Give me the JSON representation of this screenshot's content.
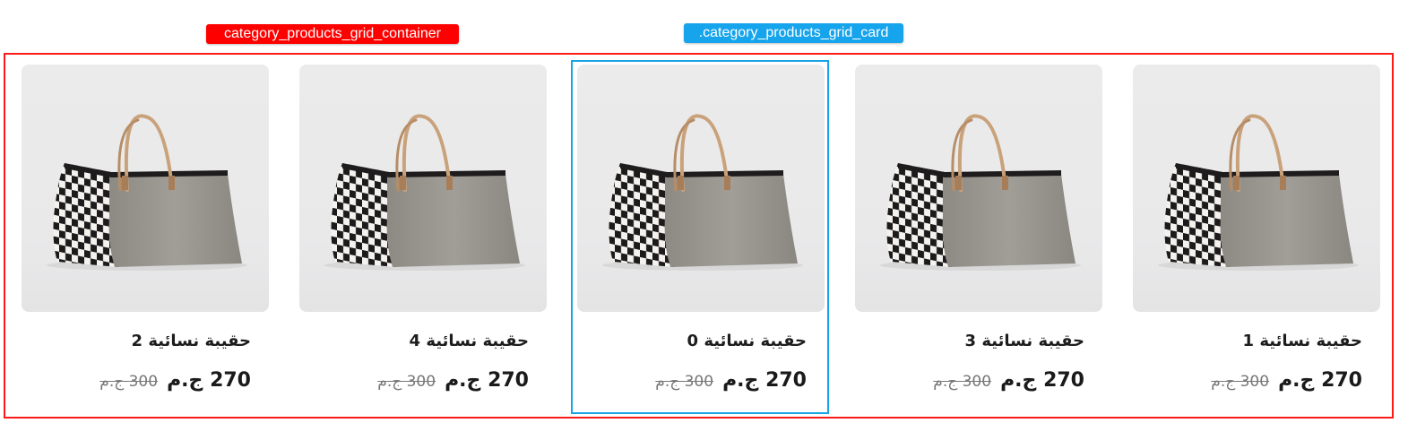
{
  "annotations": {
    "container_label": "category_products_grid_container",
    "card_label": ".category_products_grid_card"
  },
  "colors": {
    "container_outline": "#ff0000",
    "card_outline": "#1aa4e8"
  },
  "products": [
    {
      "title": "حقيبة نسائية 2",
      "price": "270 ج.م",
      "old_price": "300 ج.م"
    },
    {
      "title": "حقيبة نسائية 4",
      "price": "270 ج.م",
      "old_price": "300 ج.م"
    },
    {
      "title": "حقيبة نسائية 0",
      "price": "270 ج.م",
      "old_price": "300 ج.م"
    },
    {
      "title": "حقيبة نسائية 3",
      "price": "270 ج.م",
      "old_price": "300 ج.م"
    },
    {
      "title": "حقيبة نسائية 1",
      "price": "270 ج.م",
      "old_price": "300 ج.م"
    }
  ]
}
